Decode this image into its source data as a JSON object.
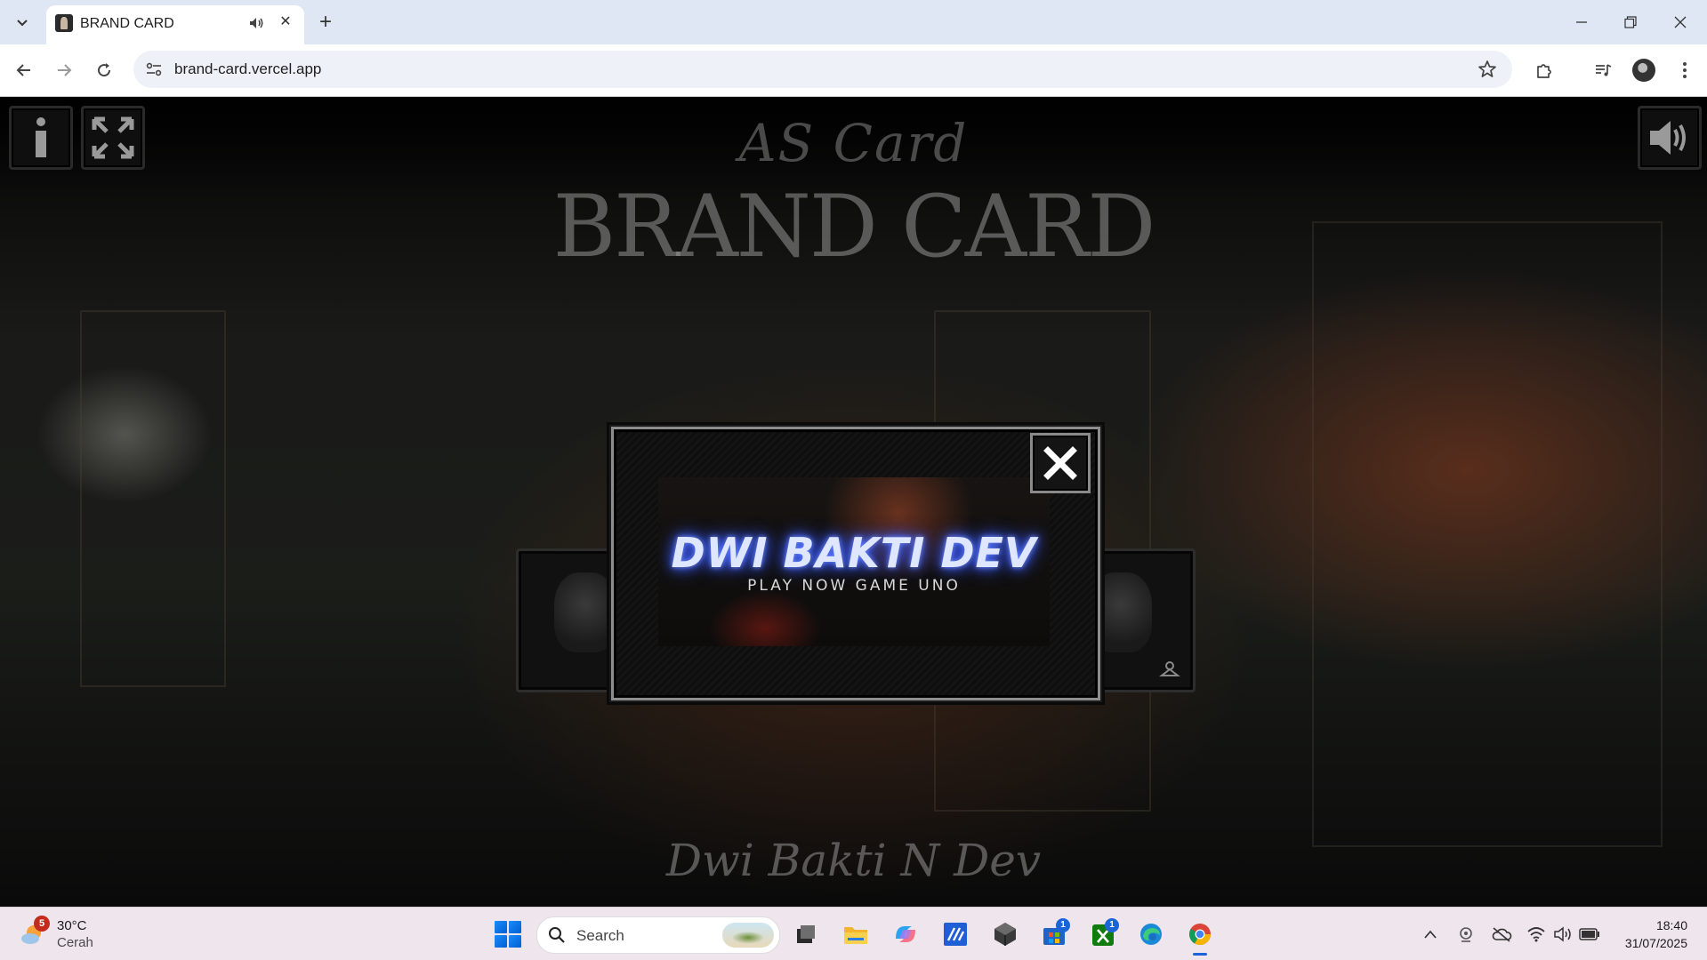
{
  "browser": {
    "tab": {
      "title": "BRAND CARD"
    },
    "address": {
      "url": "brand-card.vercel.app"
    }
  },
  "page": {
    "sub_logo": "AS Card",
    "logo": "BRAND CARD",
    "modal": {
      "banner_title": "DWI BAKTI DEV",
      "banner_subtitle": "PLAY NOW GAME UNO"
    },
    "signature": "Dwi Bakti N Dev"
  },
  "taskbar": {
    "weather": {
      "badge": "5",
      "temperature": "30°C",
      "condition": "Cerah"
    },
    "search": {
      "label": "Search"
    },
    "badges": {
      "store": "1",
      "xbox": "1"
    },
    "clock": {
      "time": "18:40",
      "date": "31/07/2025"
    }
  },
  "colors": {
    "glow_blue": "#4060ff",
    "modal_border": "#8d8d8d",
    "taskbar_bg": "#efe5ec"
  }
}
